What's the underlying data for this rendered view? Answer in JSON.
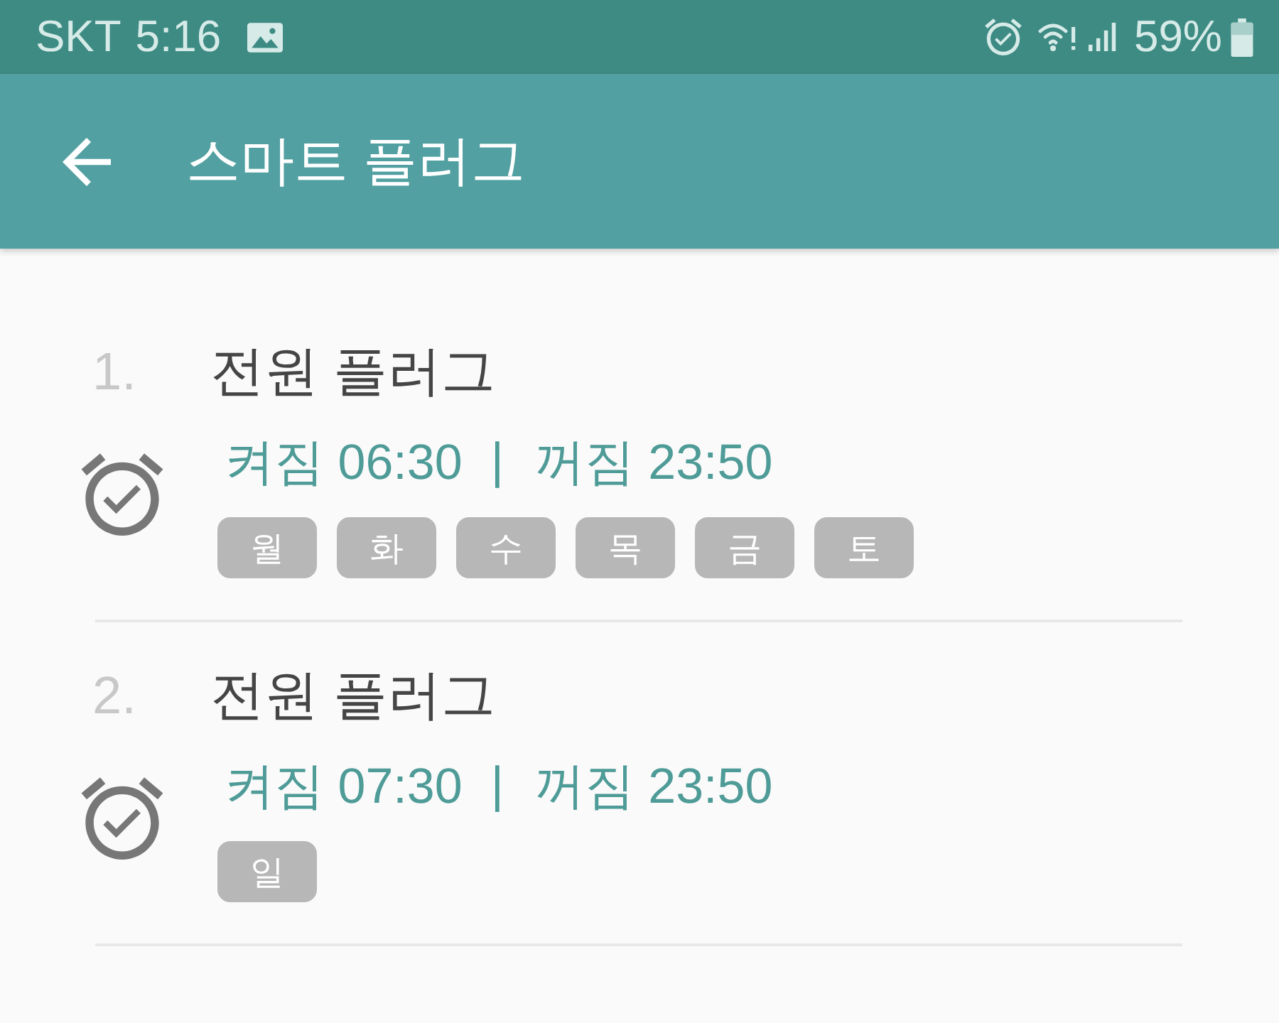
{
  "status_bar": {
    "carrier": "SKT",
    "time": "5:16",
    "battery": "59%"
  },
  "app_bar": {
    "title": "스마트 플러그"
  },
  "schedules": [
    {
      "number": "1.",
      "name": "전원 플러그",
      "on_time": "켜짐 06:30",
      "separator": "|",
      "off_time": "꺼짐 23:50",
      "days": [
        "월",
        "화",
        "수",
        "목",
        "금",
        "토"
      ]
    },
    {
      "number": "2.",
      "name": "전원 플러그",
      "on_time": "켜짐 07:30",
      "separator": "|",
      "off_time": "꺼짐 23:50",
      "days": [
        "일"
      ]
    }
  ]
}
